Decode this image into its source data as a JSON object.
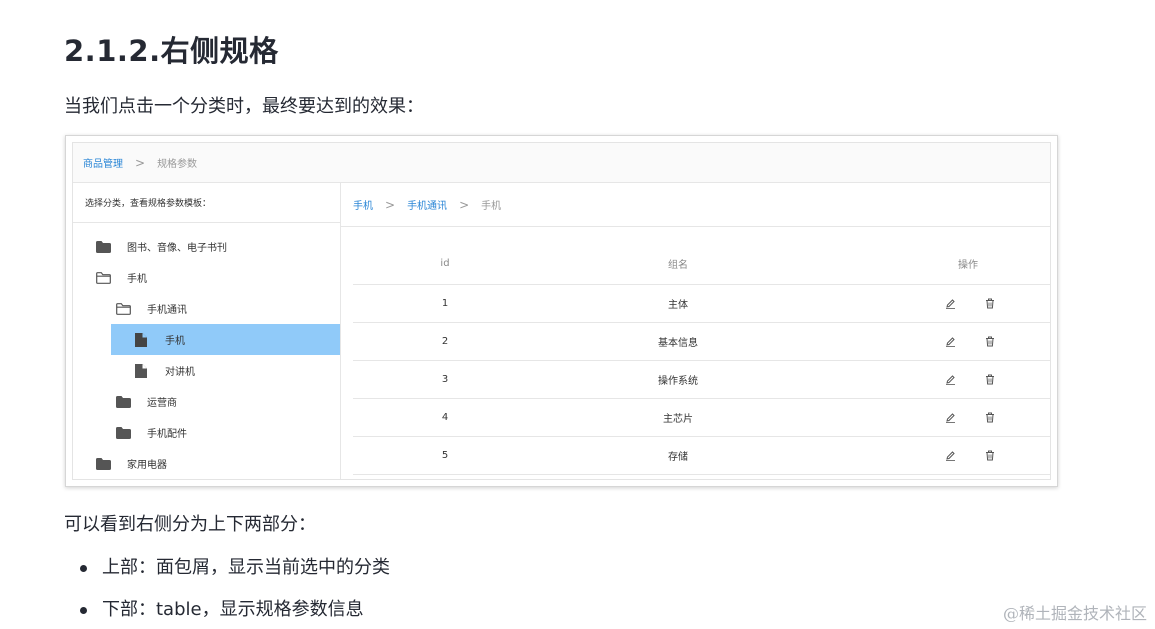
{
  "heading": "2.1.2.右侧规格",
  "intro": "当我们点击一个分类时，最终要达到的效果：",
  "screenshot": {
    "top_breadcrumb": {
      "link": "商品管理",
      "separator": ">",
      "current": "规格参数"
    },
    "left_panel": {
      "header": "选择分类，查看规格参数模板：",
      "tree": [
        {
          "label": "图书、音像、电子书刊",
          "icon": "folder-filled-icon"
        },
        {
          "label": "手机",
          "icon": "folder-open-icon"
        },
        {
          "label": "手机通讯",
          "icon": "folder-open-icon"
        },
        {
          "label": "手机",
          "icon": "file-icon",
          "selected": true
        },
        {
          "label": "对讲机",
          "icon": "file-icon"
        },
        {
          "label": "运营商",
          "icon": "folder-filled-icon"
        },
        {
          "label": "手机配件",
          "icon": "folder-filled-icon"
        },
        {
          "label": "家用电器",
          "icon": "folder-filled-icon"
        }
      ]
    },
    "right_breadcrumb": {
      "level1": "手机",
      "level2": "手机通讯",
      "current": "手机",
      "separator": ">"
    },
    "table": {
      "headers": {
        "id": "id",
        "name": "组名",
        "ops": "操作"
      },
      "rows": [
        {
          "id": "1",
          "name": "主体"
        },
        {
          "id": "2",
          "name": "基本信息"
        },
        {
          "id": "3",
          "name": "操作系统"
        },
        {
          "id": "4",
          "name": "主芯片"
        },
        {
          "id": "5",
          "name": "存储"
        }
      ]
    },
    "colors": {
      "link": "#2a86d6",
      "selected_bg": "#90caf9"
    }
  },
  "summary": "可以看到右侧分为上下两部分：",
  "bullets": [
    "上部：面包屑，显示当前选中的分类",
    "下部：table，显示规格参数信息"
  ],
  "watermark": "@稀土掘金技术社区"
}
